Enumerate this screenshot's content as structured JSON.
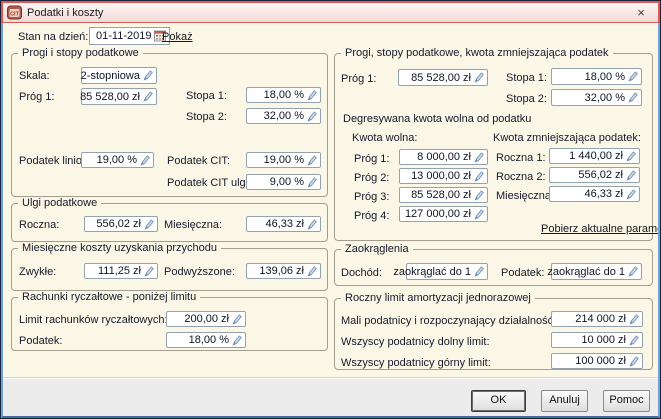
{
  "window": {
    "title": "Podatki i koszty",
    "close_glyph": "×"
  },
  "header": {
    "date_label": "Stan na dzień:",
    "date_value": "01-11-2019",
    "show_link": "Pokaż"
  },
  "left": {
    "tax_scale": {
      "legend": "Progi i stopy podatkowe",
      "skala_label": "Skala:",
      "skala_value": "2-stopniowa",
      "prog1_label": "Próg 1:",
      "prog1_value": "85 528,00 zł",
      "stopa1_label": "Stopa 1:",
      "stopa1_value": "18,00 %",
      "stopa2_label": "Stopa 2:",
      "stopa2_value": "32,00 %",
      "liniowy_label": "Podatek liniowy:",
      "liniowy_value": "19,00 %",
      "cit_label": "Podatek CIT:",
      "cit_value": "19,00 %",
      "cit_ulgowy_label": "Podatek CIT ulgowy:",
      "cit_ulgowy_value": "9,00 %"
    },
    "ulgi": {
      "legend": "Ulgi podatkowe",
      "roczna_label": "Roczna:",
      "roczna_value": "556,02 zł",
      "miesieczna_label": "Miesięczna:",
      "miesieczna_value": "46,33 zł"
    },
    "koszty": {
      "legend": "Miesięczne koszty uzyskania przychodu",
      "zwykle_label": "Zwykłe:",
      "zwykle_value": "111,25 zł",
      "podwyzszone_label": "Podwyższone:",
      "podwyzszone_value": "139,06 zł"
    },
    "rachunki": {
      "legend": "Rachunki ryczałtowe - poniżej limitu",
      "limit_label": "Limit rachunków ryczałtowych:",
      "limit_value": "200,00 zł",
      "podatek_label": "Podatek:",
      "podatek_value": "18,00 %"
    }
  },
  "right": {
    "progi": {
      "legend": "Progi, stopy podatkowe, kwota zmniejszająca podatek",
      "prog1_label": "Próg 1:",
      "prog1_value": "85 528,00 zł",
      "stopa1_label": "Stopa 1:",
      "stopa1_value": "18,00 %",
      "stopa2_label": "Stopa 2:",
      "stopa2_value": "32,00 %",
      "degresywna_title": "Degresywana kwota wolna od podatku",
      "kwota_wolna_header": "Kwota wolna:",
      "kwota_zmniejszajaca_header": "Kwota zmniejszająca podatek:",
      "kw_prog1_label": "Próg 1:",
      "kw_prog1_value": "8 000,00 zł",
      "kw_prog2_label": "Próg 2:",
      "kw_prog2_value": "13 000,00 zł",
      "kw_prog3_label": "Próg 3:",
      "kw_prog3_value": "85 528,00 zł",
      "kw_prog4_label": "Próg 4:",
      "kw_prog4_value": "127 000,00 zł",
      "roczna1_label": "Roczna 1:",
      "roczna1_value": "1 440,00 zł",
      "roczna2_label": "Roczna 2:",
      "roczna2_value": "556,02 zł",
      "miesieczna_label": "Miesięczna:",
      "miesieczna_value": "46,33 zł",
      "download_link": "Pobierz aktualne parametry"
    },
    "zaokraglenia": {
      "legend": "Zaokrąglenia",
      "dochod_label": "Dochód:",
      "dochod_value": "zaokrąglać do 1",
      "podatek_label": "Podatek:",
      "podatek_value": "zaokrąglać do 1"
    },
    "amortyzacja": {
      "legend": "Roczny limit amortyzacji jednorazowej",
      "mali_label": "Mali podatnicy i rozpoczynający działalność gosp.:",
      "mali_value": "214 000 zł",
      "dolny_label": "Wszyscy podatnicy dolny limit:",
      "dolny_value": "10 000 zł",
      "gorny_label": "Wszyscy podatnicy górny limit:",
      "gorny_value": "100 000 zł"
    }
  },
  "footer": {
    "ok": "OK",
    "cancel": "Anuluj",
    "help": "Pomoc"
  },
  "colors": {
    "accent_red": "#e1564e",
    "frame_blue": "#6fa3da",
    "content_bg": "#fbf7e6",
    "footer_bg": "#ececec"
  }
}
